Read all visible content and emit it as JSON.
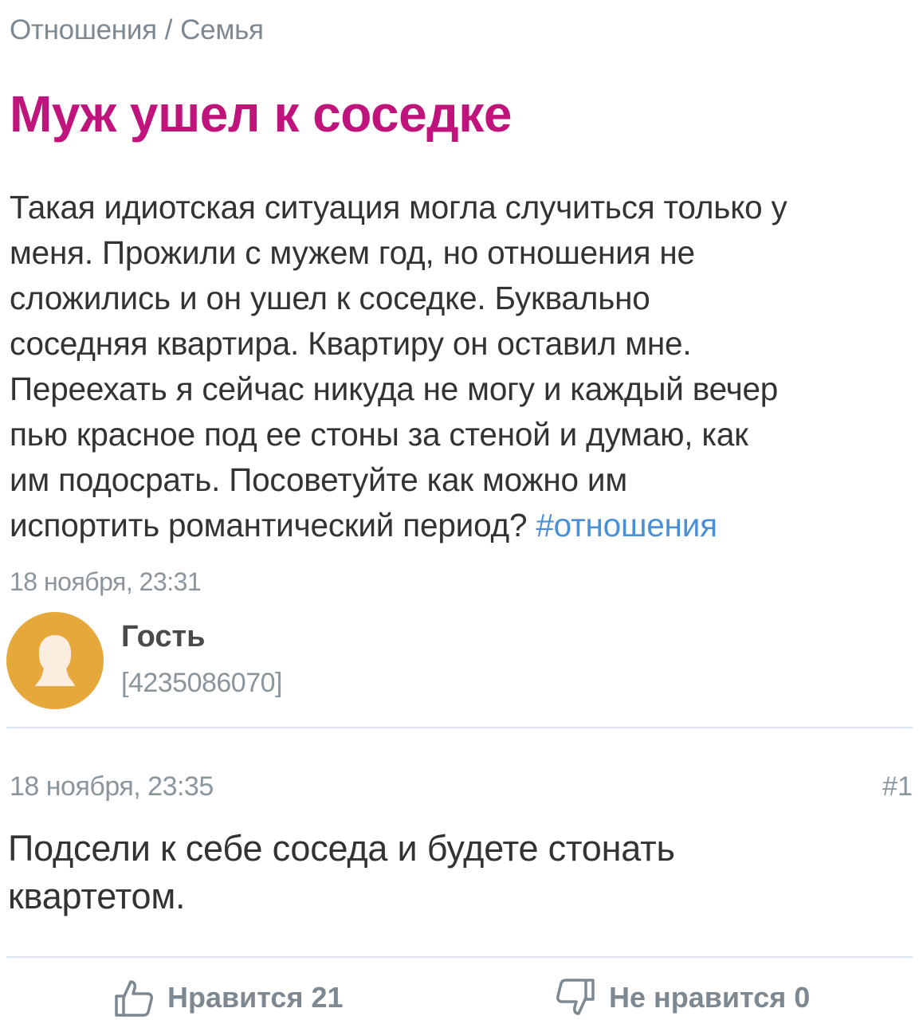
{
  "breadcrumb": {
    "category": "Отношения",
    "separator": "/",
    "subcategory": "Семья"
  },
  "post": {
    "title": "Муж ушел к соседке",
    "body_lines": [
      "Такая идиотская ситуация могла случиться только у",
      "меня. Прожили с мужем год, но отношения не",
      "сложились и он ушел к соседке. Буквально",
      "соседняя квартира. Квартиру он оставил мне.",
      "Переехать я сейчас никуда не могу и каждый вечер",
      "пью красное под ее стоны за стеной и думаю, как",
      "им подосрать. Посоветуйте как можно им",
      "испортить романтический период?"
    ],
    "hashtag": "#отношения",
    "date": "18 ноября, 23:31"
  },
  "author": {
    "name": "Гость",
    "id": "[4235086070]",
    "avatar_icon": "guest-silhouette-icon",
    "avatar_color": "#e6a83a"
  },
  "comment": {
    "date": "18 ноября, 23:35",
    "number": "#1",
    "text_lines": [
      "Подсели к себе соседа и будете стонать",
      "квартетом."
    ],
    "likes": {
      "label": "Нравится 21",
      "icon": "thumbs-up-icon"
    },
    "dislikes": {
      "label": "Не нравится 0",
      "icon": "thumbs-down-icon"
    }
  },
  "colors": {
    "title": "#c0147d",
    "hashtag": "#4a90d9",
    "muted": "#8a959c",
    "divider": "#dde6ef"
  }
}
